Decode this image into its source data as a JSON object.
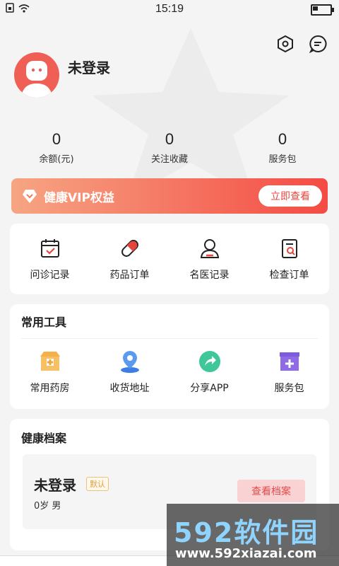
{
  "status": {
    "time": "15:19",
    "battery_level": 0.3
  },
  "profile": {
    "username": "未登录"
  },
  "stats": [
    {
      "value": "0",
      "label": "余额(元)"
    },
    {
      "value": "0",
      "label": "关注收藏"
    },
    {
      "value": "0",
      "label": "服务包"
    }
  ],
  "vip": {
    "title": "健康VIP权益",
    "button": "立即查看"
  },
  "orders": [
    {
      "label": "问诊记录",
      "icon": "calendar-check-icon"
    },
    {
      "label": "药品订单",
      "icon": "pill-icon"
    },
    {
      "label": "名医记录",
      "icon": "doctor-icon"
    },
    {
      "label": "检查订单",
      "icon": "report-search-icon"
    }
  ],
  "tools": {
    "title": "常用工具",
    "items": [
      {
        "label": "常用药房",
        "icon": "pharmacy-icon"
      },
      {
        "label": "收货地址",
        "icon": "location-pin-icon"
      },
      {
        "label": "分享APP",
        "icon": "share-icon"
      },
      {
        "label": "服务包",
        "icon": "service-box-icon"
      }
    ]
  },
  "health": {
    "title": "健康档案",
    "name": "未登录",
    "badge": "默认",
    "info": "0岁  男",
    "button": "查看档案"
  },
  "watermark": {
    "brand": "592软件园",
    "url": "www.592xiazai.com"
  },
  "colors": {
    "accent": "#ef5f55",
    "vip_start": "#f6a583",
    "vip_end": "#f44b44"
  }
}
